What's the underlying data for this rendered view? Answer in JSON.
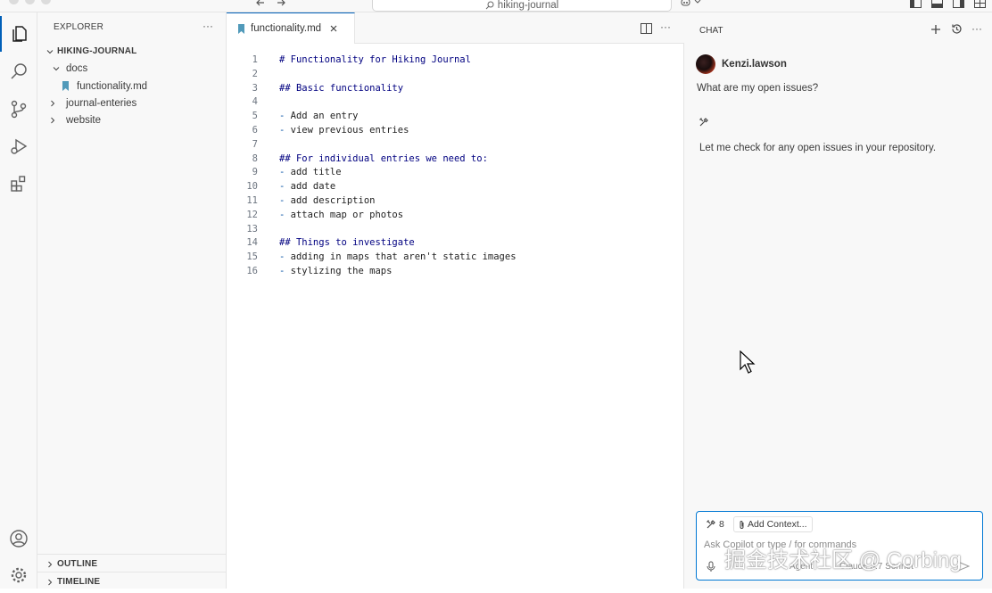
{
  "titlebar": {
    "search_text": "hiking-journal"
  },
  "sidebar": {
    "header": "EXPLORER",
    "more": "···",
    "root_label": "HIKING-JOURNAL",
    "tree": [
      {
        "label": "docs",
        "kind": "folder-open"
      },
      {
        "label": "functionality.md",
        "kind": "markdown-file"
      },
      {
        "label": "journal-enteries",
        "kind": "folder-closed"
      },
      {
        "label": "website",
        "kind": "folder-closed"
      }
    ],
    "sections": [
      "OUTLINE",
      "TIMELINE"
    ]
  },
  "editor": {
    "tab_label": "functionality.md",
    "more": "···",
    "lines": [
      {
        "n": "1",
        "text": "# Functionality for Hiking Journal",
        "kind": "heading"
      },
      {
        "n": "2",
        "text": "",
        "kind": "plain"
      },
      {
        "n": "3",
        "text": "## Basic functionality",
        "kind": "heading"
      },
      {
        "n": "4",
        "text": "",
        "kind": "plain"
      },
      {
        "n": "5",
        "bullet": "-",
        "text": " Add an entry",
        "kind": "bullet"
      },
      {
        "n": "6",
        "bullet": "-",
        "text": " view previous entries",
        "kind": "bullet"
      },
      {
        "n": "7",
        "text": "",
        "kind": "plain"
      },
      {
        "n": "8",
        "text": "## For individual entries we need to:",
        "kind": "heading"
      },
      {
        "n": "9",
        "bullet": "-",
        "text": " add title",
        "kind": "bullet"
      },
      {
        "n": "10",
        "bullet": "-",
        "text": " add date",
        "kind": "bullet"
      },
      {
        "n": "11",
        "bullet": "-",
        "text": " add description",
        "kind": "bullet"
      },
      {
        "n": "12",
        "bullet": "-",
        "text": " attach map or photos",
        "kind": "bullet"
      },
      {
        "n": "13",
        "text": "",
        "kind": "plain"
      },
      {
        "n": "14",
        "text": "## Things to investigate",
        "kind": "heading"
      },
      {
        "n": "15",
        "bullet": "-",
        "text": " adding in maps that aren't static images",
        "kind": "bullet"
      },
      {
        "n": "16",
        "bullet": "-",
        "text": " stylizing the maps",
        "kind": "bullet"
      }
    ]
  },
  "chat": {
    "header": "CHAT",
    "more": "···",
    "user_name": "Kenzi.lawson",
    "user_message": "What are my open issues?",
    "assistant_message": "Let me check for any open issues in your repository.",
    "tools_count": "8",
    "add_context": "Add Context...",
    "input_placeholder": "Ask Copilot or type / for commands",
    "mode": "Agent",
    "model": "Claude 3.7 Sonnet"
  },
  "watermark": "掘金技术社区 @ Corbing",
  "colors": {
    "accent": "#005fb8",
    "heading_code": "#000080",
    "bullet_code": "#0451a5",
    "markdown_icon": "#519aba"
  }
}
